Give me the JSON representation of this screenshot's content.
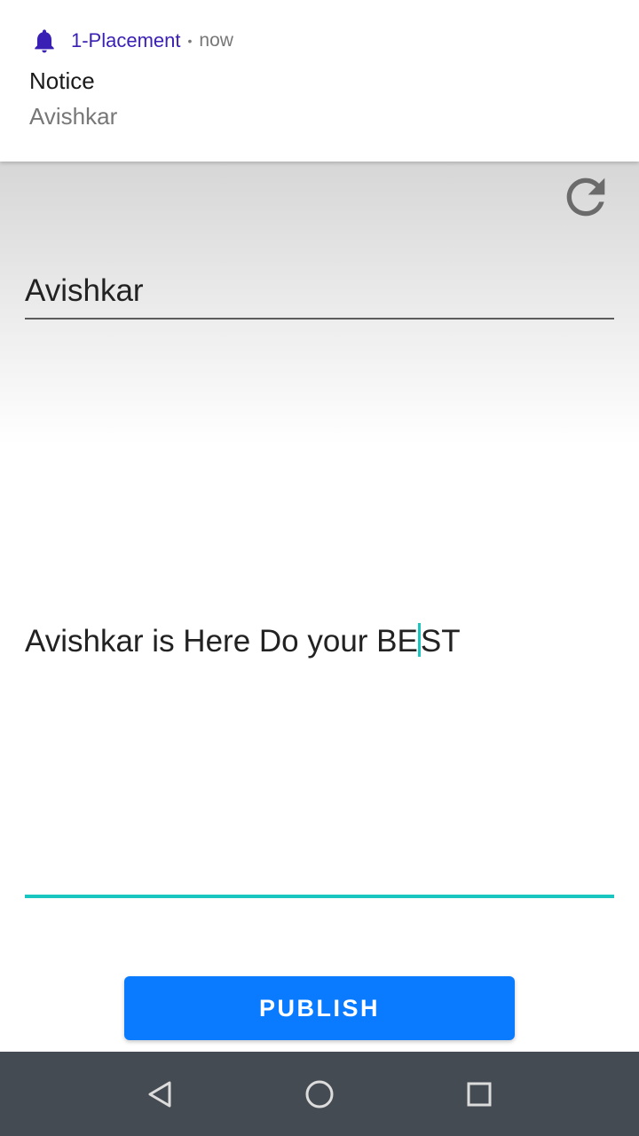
{
  "notification": {
    "app_name": "1-Placement",
    "separator": "•",
    "time": "now",
    "title": "Notice",
    "text": "Avishkar"
  },
  "form": {
    "title_value": "Avishkar",
    "body_before_cursor": "Avishkar is Here Do your BE",
    "body_after_cursor": "ST",
    "publish_label": "PUBLISH"
  },
  "icons": {
    "bell": "bell-icon",
    "refresh": "refresh-icon",
    "back": "back-triangle-icon",
    "home": "home-circle-icon",
    "recents": "recents-square-icon"
  },
  "colors": {
    "accent": "#19c7c0",
    "button": "#0a7bff",
    "notification_app": "#3a1fb5",
    "navbar": "#454b52"
  }
}
